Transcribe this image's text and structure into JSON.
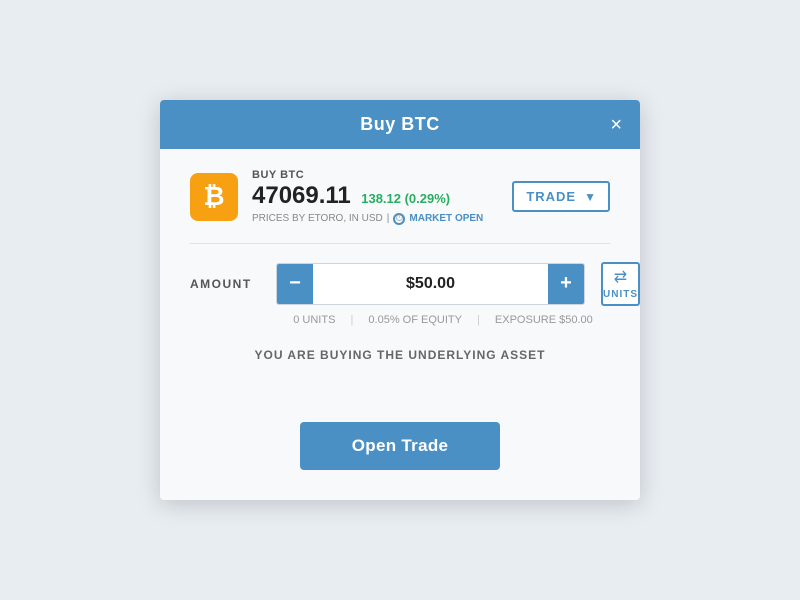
{
  "modal": {
    "title": "Buy BTC",
    "close_label": "×"
  },
  "asset": {
    "label": "BUY BTC",
    "price": "47069.11",
    "change": "138.12 (0.29%)",
    "meta": "PRICES BY ETORO, IN USD",
    "market_status": "MARKET OPEN",
    "icon": "₿"
  },
  "trade_dropdown": {
    "label": "TRADE",
    "arrow": "▼"
  },
  "amount": {
    "label": "AMOUNT",
    "value": "$50.00",
    "minus": "−",
    "plus": "+"
  },
  "units_toggle": {
    "icon": "⇄",
    "label": "UNITS"
  },
  "amount_info": {
    "units": "0 UNITS",
    "equity": "0.05% OF EQUITY",
    "exposure": "EXPOSURE $50.00"
  },
  "underlying_message": "YOU ARE BUYING THE UNDERLYING ASSET",
  "open_trade_button": "Open Trade"
}
